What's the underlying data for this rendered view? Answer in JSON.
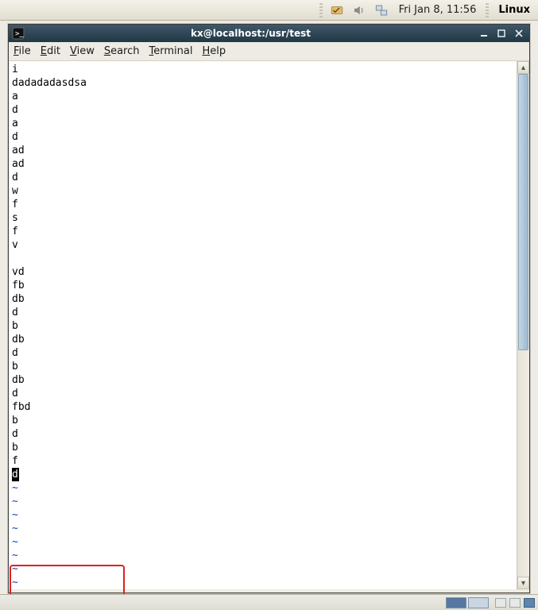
{
  "panel": {
    "clock_text": "Fri Jan  8, 11:56",
    "os_label": "Linux"
  },
  "window": {
    "title": "kx@localhost:/usr/test"
  },
  "menu": {
    "file": "File",
    "edit": "Edit",
    "view": "View",
    "search": "Search",
    "terminal": "Terminal",
    "help": "Help"
  },
  "terminal": {
    "lines": [
      "i",
      "dadadadasdsa",
      "a",
      "d",
      "a",
      "d",
      "ad",
      "ad",
      "d",
      "w",
      "f",
      "s",
      "f",
      "v",
      "",
      "vd",
      "fb",
      "db",
      "d",
      "b",
      "db",
      "d",
      "b",
      "db",
      "d",
      "fbd",
      "b",
      "d",
      "b",
      "f"
    ],
    "cursor_line": "d",
    "tilde_count": 8
  }
}
